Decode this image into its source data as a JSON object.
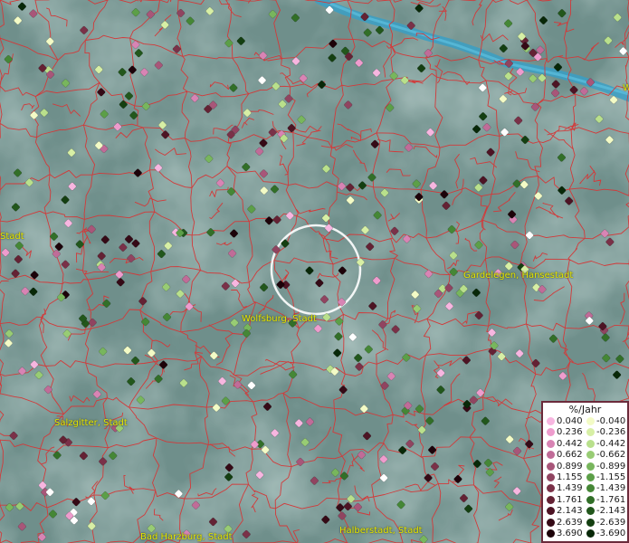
{
  "map": {
    "background": "#6f8f8b",
    "border_color": "#d23a3a",
    "river_color": "#3a9fc4",
    "labels": [
      {
        "id": "label-stadt-west",
        "text": "Stadt"
      },
      {
        "id": "label-wolfsburg",
        "text": "Wolfsburg, Stadt"
      },
      {
        "id": "label-gardelegen",
        "text": "Gardelegen, Hansestadt"
      },
      {
        "id": "label-salzgitter",
        "text": "Salzgitter, Stadt"
      },
      {
        "id": "label-bad-harzburg",
        "text": "Bad Harzburg, Stadt"
      },
      {
        "id": "label-halberstadt",
        "text": "Halberstadt, Stadt"
      },
      {
        "id": "label-edge-w",
        "text": "W"
      }
    ]
  },
  "legend": {
    "title": "%/Jahr",
    "positive": [
      {
        "value": "0.040",
        "color": "#f7b6e0"
      },
      {
        "value": "0.236",
        "color": "#ee9ccd"
      },
      {
        "value": "0.442",
        "color": "#d884b4"
      },
      {
        "value": "0.662",
        "color": "#c06c98"
      },
      {
        "value": "0.899",
        "color": "#a85679"
      },
      {
        "value": "1.155",
        "color": "#904460"
      },
      {
        "value": "1.439",
        "color": "#7a3148"
      },
      {
        "value": "1.761",
        "color": "#642234"
      },
      {
        "value": "2.143",
        "color": "#4d1424"
      },
      {
        "value": "2.639",
        "color": "#350a16"
      },
      {
        "value": "3.690",
        "color": "#1c0209"
      }
    ],
    "negative": [
      {
        "value": "-0.040",
        "color": "#f3fbc6"
      },
      {
        "value": "-0.236",
        "color": "#d7efa5"
      },
      {
        "value": "-0.442",
        "color": "#b9e08c"
      },
      {
        "value": "-0.662",
        "color": "#98cc74"
      },
      {
        "value": "-0.899",
        "color": "#78b65d"
      },
      {
        "value": "-1.155",
        "color": "#5c9f48"
      },
      {
        "value": "-1.439",
        "color": "#458736"
      },
      {
        "value": "-1.761",
        "color": "#326f28"
      },
      {
        "value": "-2.143",
        "color": "#22571c"
      },
      {
        "value": "-2.639",
        "color": "#143f11"
      },
      {
        "value": "-3.690",
        "color": "#082808"
      }
    ]
  }
}
